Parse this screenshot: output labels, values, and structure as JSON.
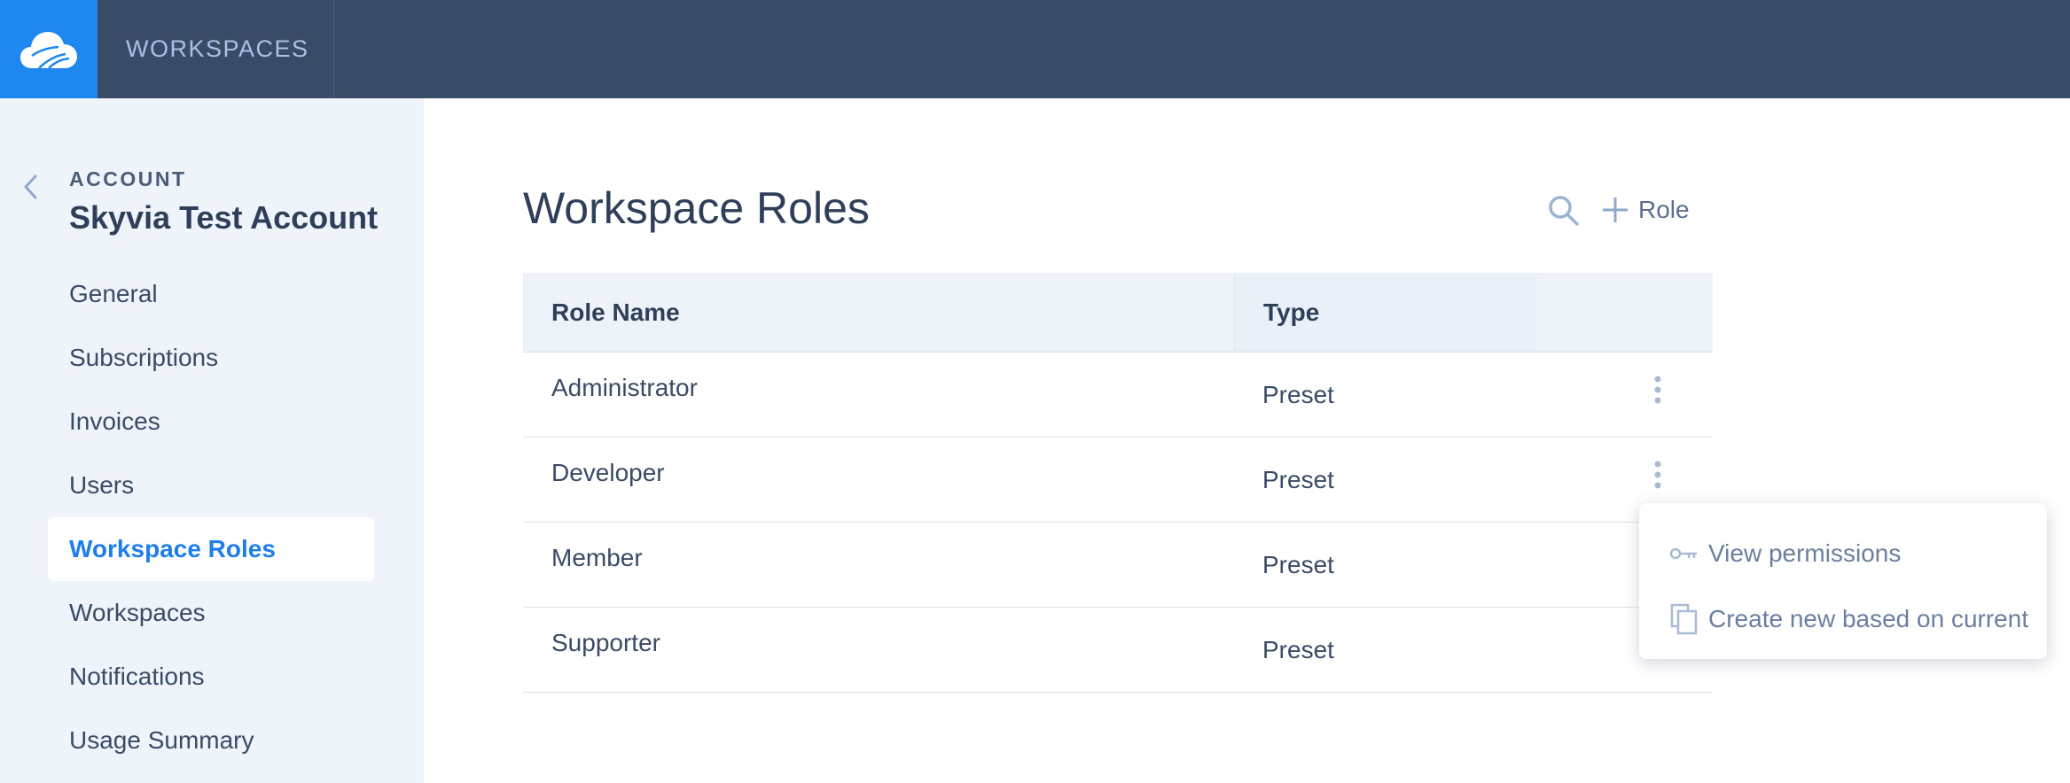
{
  "topbar": {
    "title": "WORKSPACES",
    "brand_color": "#1e88f0",
    "bar_color": "#3a4b68"
  },
  "sidebar": {
    "account_label": "ACCOUNT",
    "account_name": "Skyvia Test Account",
    "items": [
      {
        "label": "General",
        "active": false
      },
      {
        "label": "Subscriptions",
        "active": false
      },
      {
        "label": "Invoices",
        "active": false
      },
      {
        "label": "Users",
        "active": false
      },
      {
        "label": "Workspace Roles",
        "active": true
      },
      {
        "label": "Workspaces",
        "active": false
      },
      {
        "label": "Notifications",
        "active": false
      },
      {
        "label": "Usage Summary",
        "active": false
      }
    ]
  },
  "main": {
    "title": "Workspace Roles",
    "add_role_label": "Role",
    "table": {
      "columns": [
        "Role Name",
        "Type"
      ],
      "rows": [
        {
          "name": "Administrator",
          "type": "Preset"
        },
        {
          "name": "Developer",
          "type": "Preset"
        },
        {
          "name": "Member",
          "type": "Preset"
        },
        {
          "name": "Supporter",
          "type": "Preset"
        }
      ]
    }
  },
  "context_menu": {
    "items": [
      {
        "label": "View permissions",
        "icon": "key-icon"
      },
      {
        "label": "Create new based on current",
        "icon": "copy-icon"
      }
    ]
  },
  "icons": {
    "logo": "cloud-logo-icon",
    "back": "chevron-left-icon",
    "search": "search-icon",
    "add": "plus-icon",
    "row_menu": "kebab-menu-icon"
  }
}
